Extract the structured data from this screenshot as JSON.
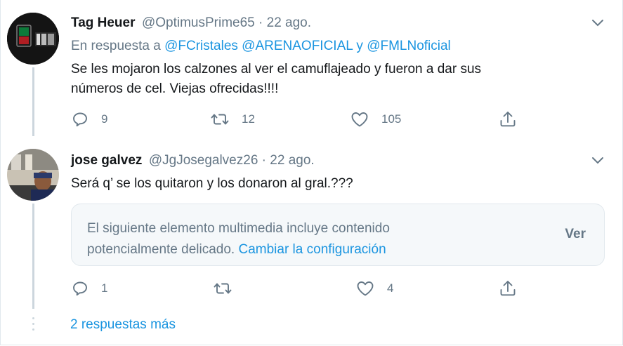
{
  "tweets": [
    {
      "name": "Tag Heuer",
      "handle": "@OptimusPrime65",
      "sep": " · ",
      "date": "22 ago.",
      "reply_prefix": "En respuesta a",
      "reply_mentions": [
        "@FCristales",
        "@ARENAOFICIAL",
        "@FMLNoficial"
      ],
      "reply_conj": "y",
      "text_lines": [
        "Se les mojaron los calzones al ver el camuflajeado y fueron a dar sus",
        "números de cel. Viejas ofrecidas!!!!"
      ],
      "replies": "9",
      "retweets": "12",
      "likes": "105"
    },
    {
      "name": "jose galvez",
      "handle": "@JgJosegalvez26",
      "sep": " · ",
      "date": "22 ago.",
      "text_lines": [
        "Será q’ se los quitaron y los donaron al gral.???"
      ],
      "sensitive_text": "El siguiente elemento multimedia incluye contenido potencialmente delicado.",
      "sensitive_link": "Cambiar la configuración",
      "sensitive_button": "Ver",
      "replies": "1",
      "retweets": "",
      "likes": "4"
    }
  ],
  "more_replies": "2 respuestas más",
  "colors": {
    "link": "#1b95e0",
    "secondary": "#657786",
    "border": "#e1e8ed",
    "thread": "#ccd6dd"
  },
  "icons": [
    "chevron-down-icon",
    "reply-icon",
    "retweet-icon",
    "like-icon",
    "share-icon"
  ]
}
